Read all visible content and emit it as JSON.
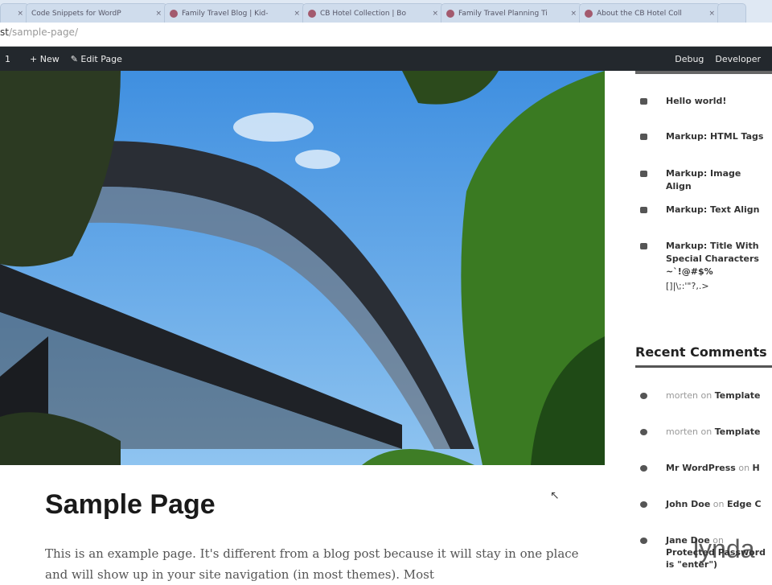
{
  "browser": {
    "tabs": [
      {
        "title": "Code Snippets for WordP"
      },
      {
        "title": "Family Travel Blog | Kid-"
      },
      {
        "title": "CB Hotel Collection | Bo"
      },
      {
        "title": "Family Travel Planning Ti"
      },
      {
        "title": "About the CB Hotel Coll"
      }
    ],
    "url_host": "st",
    "url_path": "/sample-page/"
  },
  "adminbar": {
    "left": [
      "1",
      "+ New",
      "✎ Edit Page"
    ],
    "right": [
      "Debug",
      "Developer"
    ]
  },
  "sidebar": {
    "posts": [
      "Hello world!",
      "Markup: HTML Tags",
      "Markup: Image Align",
      "Markup: Text Align",
      "Markup: Title With Special Characters ~`!@#$%",
      "[]|\\;:'\"?,.>"
    ],
    "recent_comments_title": "Recent Comments",
    "comments": [
      {
        "author": "morten",
        "on": "on",
        "post": "Template"
      },
      {
        "author": "morten",
        "on": "on",
        "post": "Template"
      },
      {
        "author": "Mr WordPress",
        "on": "on",
        "post": "H"
      },
      {
        "author": "John Doe",
        "on": "on",
        "post": "Edge C"
      },
      {
        "author": "Jane Doe",
        "on": "on",
        "post": "Protected Password",
        "post2": "is \"enter\")"
      }
    ]
  },
  "page": {
    "title": "Sample Page",
    "text": "This is an example page. It's different from a blog post because it will stay in one place and will show up in your site navigation (in most themes). Most"
  },
  "watermark": "lynda"
}
